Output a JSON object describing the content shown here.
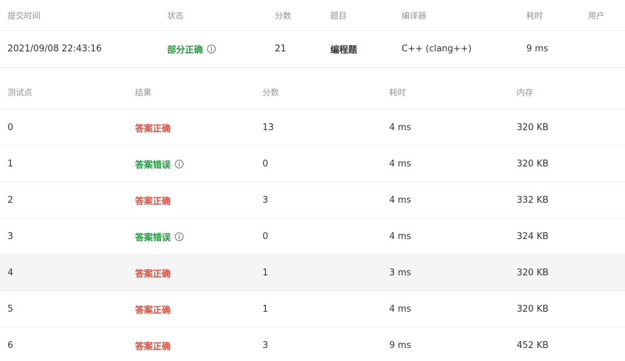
{
  "submission": {
    "headers": {
      "time": "提交时间",
      "status": "状态",
      "score": "分数",
      "problem": "题目",
      "compiler": "编译器",
      "elapsed": "耗时",
      "user": "用户"
    },
    "row": {
      "time": "2021/09/08 22:43:16",
      "status": "部分正确",
      "score": "21",
      "problem": "编程题",
      "compiler": "C++ (clang++)",
      "elapsed": "9 ms",
      "user": ""
    }
  },
  "testcases": {
    "headers": {
      "id": "测试点",
      "result": "结果",
      "score": "分数",
      "elapsed": "耗时",
      "memory": "内存"
    },
    "rows": [
      {
        "id": "0",
        "result": "答案正确",
        "score": "13",
        "elapsed": "4 ms",
        "memory": "320 KB"
      },
      {
        "id": "1",
        "result": "答案错误",
        "score": "0",
        "elapsed": "4 ms",
        "memory": "320 KB"
      },
      {
        "id": "2",
        "result": "答案正确",
        "score": "3",
        "elapsed": "4 ms",
        "memory": "332 KB"
      },
      {
        "id": "3",
        "result": "答案错误",
        "score": "0",
        "elapsed": "4 ms",
        "memory": "324 KB"
      },
      {
        "id": "4",
        "result": "答案正确",
        "score": "1",
        "elapsed": "3 ms",
        "memory": "320 KB"
      },
      {
        "id": "5",
        "result": "答案正确",
        "score": "1",
        "elapsed": "4 ms",
        "memory": "320 KB"
      },
      {
        "id": "6",
        "result": "答案正确",
        "score": "3",
        "elapsed": "9 ms",
        "memory": "452 KB"
      }
    ]
  },
  "colors": {
    "accepted": "#e74c3c",
    "wrong": "#1e9e3a",
    "partial": "#1e9e3a",
    "header_text": "#909399",
    "divider": "#ebeef5",
    "hover_row": "#f5f5f5"
  },
  "icons": {
    "info": "info-circle-icon"
  }
}
